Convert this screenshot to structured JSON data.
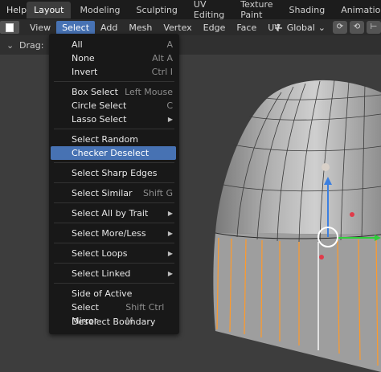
{
  "topbar": {
    "help": "Help",
    "tabs": [
      "Layout",
      "Modeling",
      "Sculpting",
      "UV Editing",
      "Texture Paint",
      "Shading",
      "Animation"
    ]
  },
  "header": {
    "items": [
      "View",
      "Select",
      "Add",
      "Mesh",
      "Vertex",
      "Edge",
      "Face",
      "UV"
    ],
    "orientation": "Global"
  },
  "toolrow": {
    "drag_label": "Drag:"
  },
  "menu": {
    "items": [
      {
        "label": "All",
        "shortcut": "A"
      },
      {
        "label": "None",
        "shortcut": "Alt A"
      },
      {
        "label": "Invert",
        "shortcut": "Ctrl I"
      },
      {
        "label": "Box Select",
        "shortcut": "Left Mouse"
      },
      {
        "label": "Circle Select",
        "shortcut": "C"
      },
      {
        "label": "Lasso Select",
        "shortcut": ""
      },
      {
        "label": "Select Random",
        "shortcut": ""
      },
      {
        "label": "Checker Deselect",
        "shortcut": ""
      },
      {
        "label": "Select Sharp Edges",
        "shortcut": ""
      },
      {
        "label": "Select Similar",
        "shortcut": "Shift G"
      },
      {
        "label": "Select All by Trait",
        "shortcut": ""
      },
      {
        "label": "Select More/Less",
        "shortcut": ""
      },
      {
        "label": "Select Loops",
        "shortcut": ""
      },
      {
        "label": "Select Linked",
        "shortcut": ""
      },
      {
        "label": "Side of Active",
        "shortcut": ""
      },
      {
        "label": "Select Mirror",
        "shortcut": "Shift Ctrl M"
      },
      {
        "label": "Deselect Boundary",
        "shortcut": ""
      }
    ],
    "highlighted": "Checker Deselect"
  },
  "colors": {
    "accent": "#4772b3",
    "selected_edge": "#ff9a2a",
    "gizmo_blue": "#3b7fe0",
    "gizmo_green": "#2fcf3a",
    "gizmo_red": "#e03b4a"
  }
}
